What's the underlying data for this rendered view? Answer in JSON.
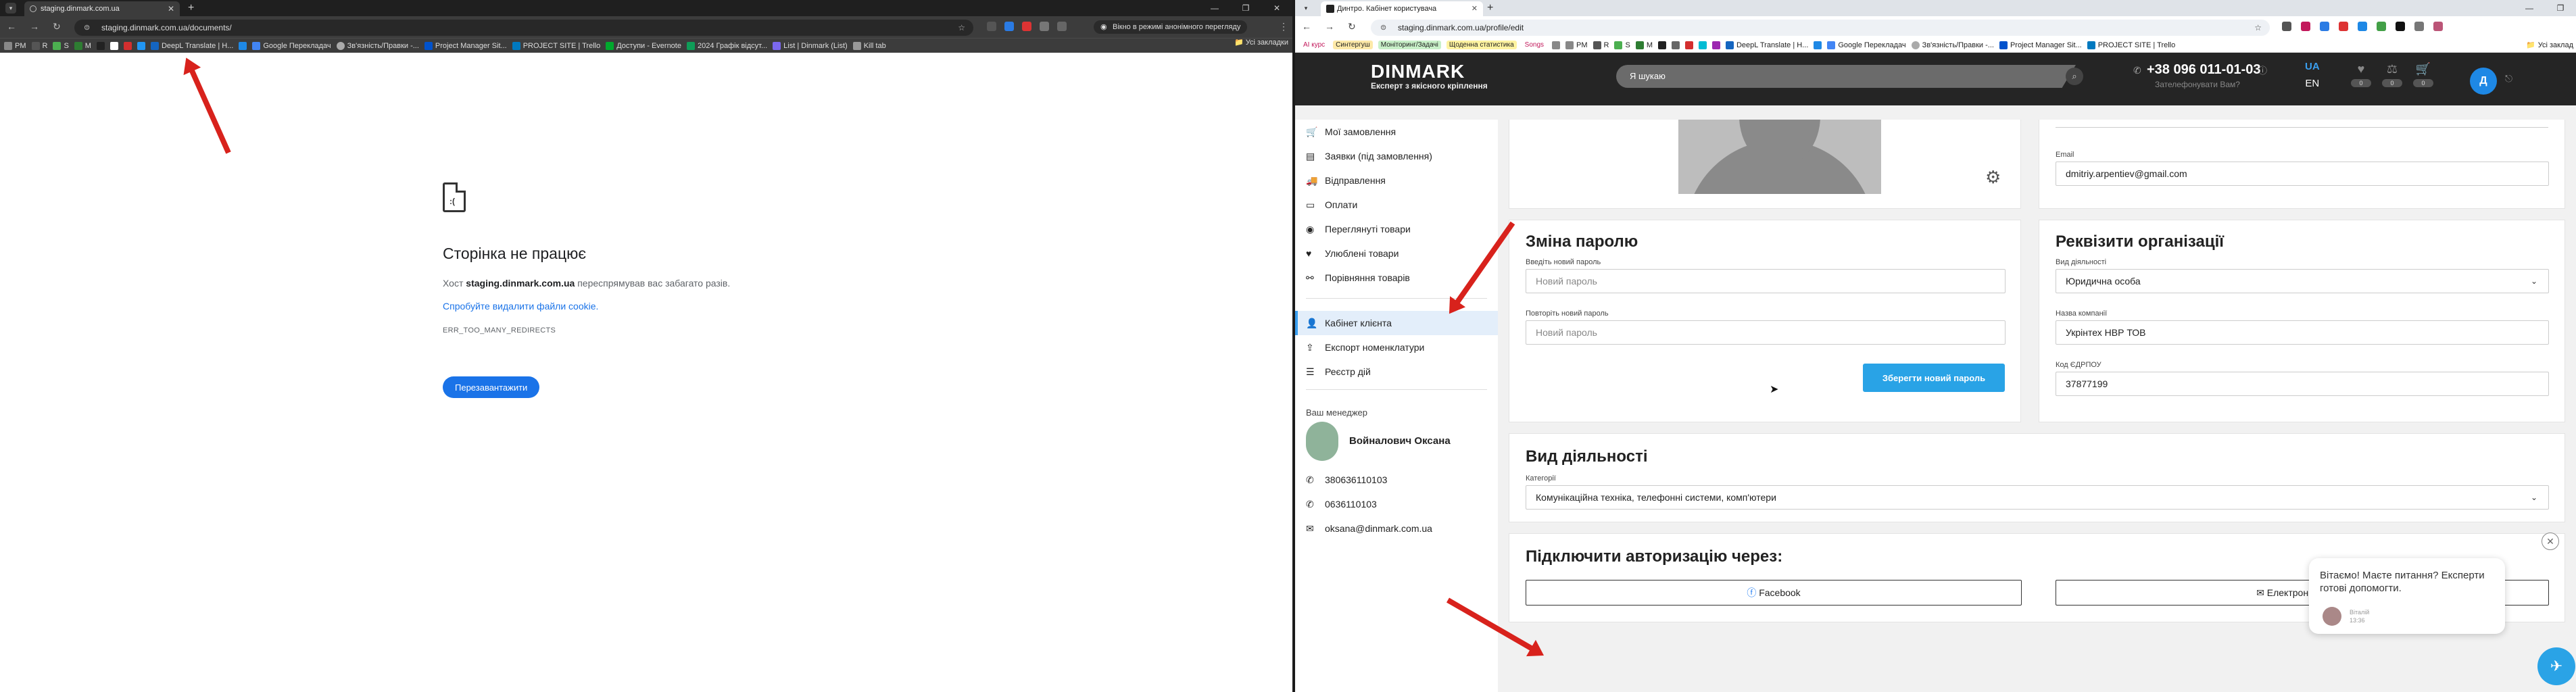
{
  "left": {
    "tab_title": "staging.dinmark.com.ua",
    "url": "staging.dinmark.com.ua/documents/",
    "incognito": "Вікно в режимі анонімного перегляду",
    "bookmarks": [
      "PM",
      "R",
      "S",
      "M",
      "",
      "",
      "",
      "",
      "DeepL Translate | Н...",
      "",
      "Google Перекладач",
      "Зв'язність/Правки -...",
      "Project Manager Sit...",
      "PROJECT SITE | Trello",
      "Доступи - Evernote",
      "2024 Графік відсут...",
      "List | Dinmark (List)",
      "Kill tab"
    ],
    "all_bookmarks": "Усі закладки",
    "error": {
      "title": "Сторінка не працює",
      "host_prefix": "Хост ",
      "host": "staging.dinmark.com.ua",
      "host_suffix": " переспрямував вас забагато разів.",
      "link": "Спробуйте видалити файли cookie.",
      "code": "ERR_TOO_MANY_REDIRECTS",
      "reload": "Перезавантажити"
    }
  },
  "right": {
    "tab_title": "Динтро. Кабінет користувача",
    "url": "staging.dinmark.com.ua/profile/edit",
    "bookmarks": [
      "AI курс",
      "Синтергуш",
      "Моніторинг/Задачі",
      "Щоденна статистика",
      "Songs",
      "",
      "PM",
      "R",
      "S",
      "M",
      "",
      "",
      "",
      "",
      "",
      "DeepL Translate | Н...",
      "",
      "Google Перекладач",
      "Зв'язність/Правки -...",
      "Project Manager Sit...",
      "PROJECT SITE | Trello"
    ],
    "all_bookmarks": "Усі заклад",
    "header": {
      "logo": "DINMARK",
      "tagline": "Експерт з якісного кріплення",
      "search_placeholder": "Я шукаю",
      "phone": "+38 096 011-01-03",
      "phone_sub": "Зателефонувати Вам?",
      "lang_active": "UA",
      "lang_other": "EN",
      "counts": [
        "0",
        "0",
        "0"
      ],
      "avatar_letter": "Д"
    },
    "sidebar": {
      "items": [
        "Мої замовлення",
        "Заявки (під замовлення)",
        "Відправлення",
        "Оплати",
        "Переглянуті товари",
        "Улюблені товари",
        "Порівняння товарів"
      ],
      "items2": [
        "Кабінет клієнта",
        "Експорт номенклатури",
        "Реєстр дій"
      ],
      "manager_title": "Ваш менеджер",
      "manager_name": "Войналович Оксана",
      "phone1": "380636110103",
      "phone2": "0636110103",
      "email": "oksana@dinmark.com.ua"
    },
    "profile": {
      "email_label": "Email",
      "email": "dmitriy.arpentiev@gmail.com"
    },
    "password": {
      "title": "Зміна паролю",
      "new_label": "Введіть новий пароль",
      "new_placeholder": "Новий пароль",
      "repeat_label": "Повторіть новий пароль",
      "repeat_placeholder": "Новий пароль",
      "save": "Зберегти новий пароль"
    },
    "org": {
      "title": "Реквізити організації",
      "activity_label": "Вид діяльності",
      "activity": "Юридична особа",
      "company_label": "Назва компанії",
      "company": "Укрінтех НВР ТОВ",
      "edrpou_label": "Код ЄДРПОУ",
      "edrpou": "37877199"
    },
    "activity": {
      "title": "Вид діяльності",
      "category_label": "Категорії",
      "category": "Комунікаційна техніка, телефонні системи, комп'ютери"
    },
    "auth": {
      "title": "Підключити авторизацію через:",
      "facebook": "Facebook",
      "email": "Електронну пошту"
    },
    "chat": {
      "message": "Вітаємо! Маєте питання? Експерти готові допомогти.",
      "agent": "Віталій",
      "time": "13:36"
    }
  },
  "colors": {
    "accent": "#29a3e6",
    "arrow": "#d8221c",
    "header_bg": "#252525"
  }
}
